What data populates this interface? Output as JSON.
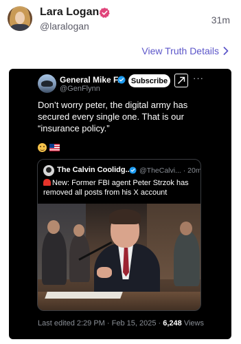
{
  "author": {
    "name": "Lara Logan",
    "handle": "@laralogan",
    "time": "31m"
  },
  "view_details": {
    "label": "View Truth Details"
  },
  "embedded": {
    "name": "General Mike F...",
    "handle": "@GenFlynn",
    "subscribe_label": "Subscribe",
    "more": "···",
    "text": "Don’t worry peter, the digital army has secured every single one. That is our “insurance policy.”",
    "quote": {
      "name": "The Calvin Coolidg...",
      "handle": "@TheCalvi...",
      "time": "· 20m",
      "text": "New: Former FBI agent Peter Strzok has removed all posts from his X account"
    },
    "footer": {
      "edited": "Last edited 2:29 PM · Feb 15, 2025 · ",
      "views_count": "6,248",
      "views_label": " Views"
    }
  },
  "colors": {
    "accent": "#5b55c9",
    "verified_pink": "#e0457b",
    "x_blue": "#1d9bf0",
    "card_bg": "#000000"
  },
  "icons": [
    "verified-badge-icon",
    "chevron-right-icon",
    "blue-check-icon",
    "grok-icon",
    "more-icon",
    "emoji-face-icon",
    "us-flag-icon",
    "siren-icon"
  ]
}
